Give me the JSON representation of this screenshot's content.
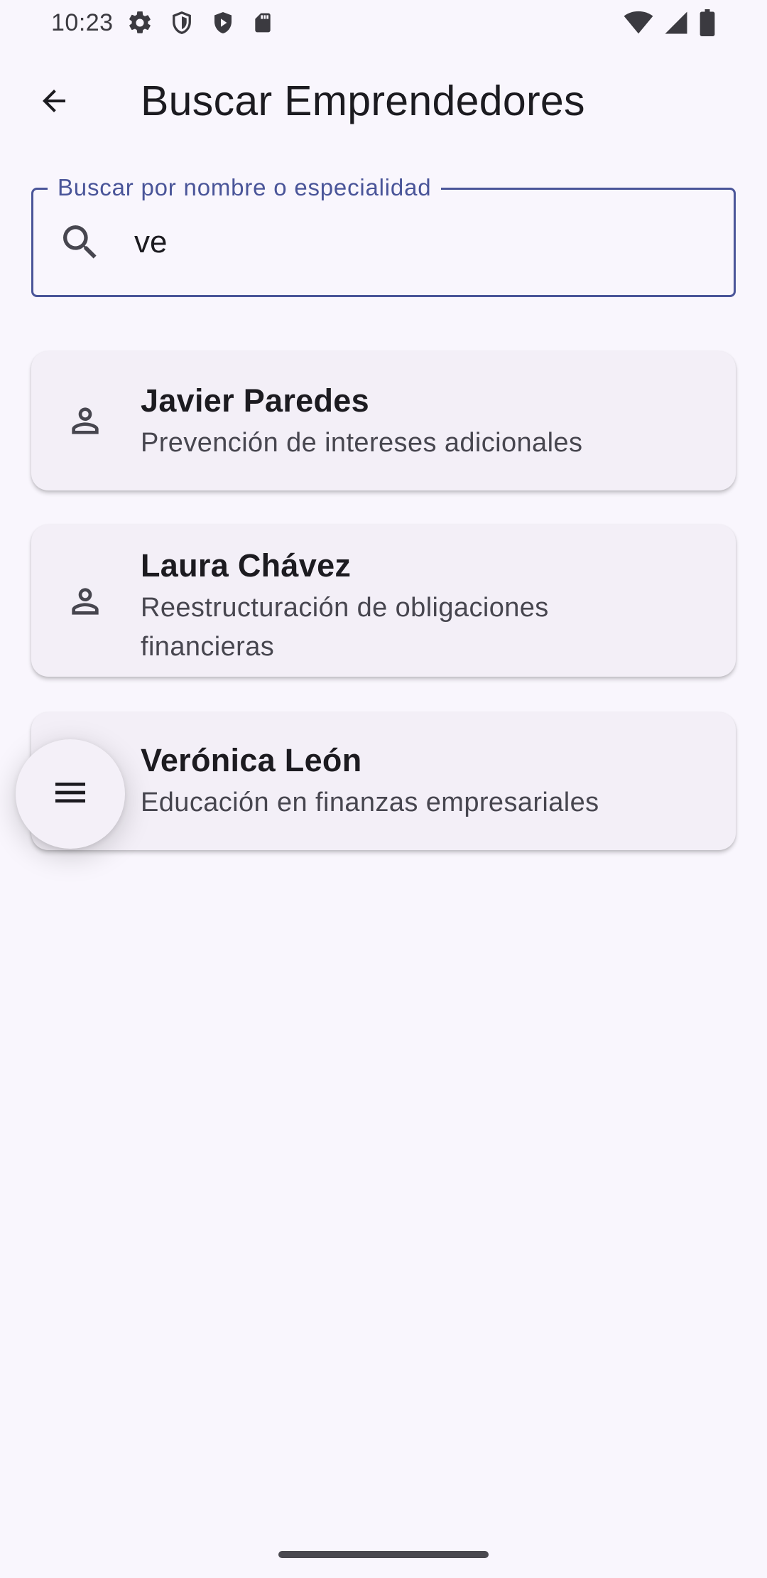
{
  "status_bar": {
    "time": "10:23",
    "left_icons": [
      "gear-icon",
      "shield-outline-icon",
      "shield-play-icon",
      "sd-card-icon"
    ],
    "right_icons": [
      "wifi-icon",
      "cellular-signal-icon",
      "battery-icon"
    ]
  },
  "app_bar": {
    "title": "Buscar Emprendedores",
    "back_icon": "arrow-back-icon"
  },
  "search": {
    "label": "Buscar por nombre o especialidad",
    "value": "ve",
    "icon": "search-icon",
    "accent_color": "#4a5599"
  },
  "results": [
    {
      "name": "Javier Paredes",
      "specialty": "Prevención de intereses adicionales",
      "icon": "person-icon"
    },
    {
      "name": "Laura Chávez",
      "specialty": "Reestructuración de obligaciones financieras",
      "icon": "person-icon"
    },
    {
      "name": "Verónica León",
      "specialty": "Educación en finanzas empresariales",
      "icon": "person-icon"
    }
  ],
  "fab": {
    "icon": "menu-icon"
  },
  "colors": {
    "background": "#f9f6fd",
    "card": "#f3eff7",
    "text_primary": "#1c1b20",
    "text_secondary": "#47464f"
  }
}
